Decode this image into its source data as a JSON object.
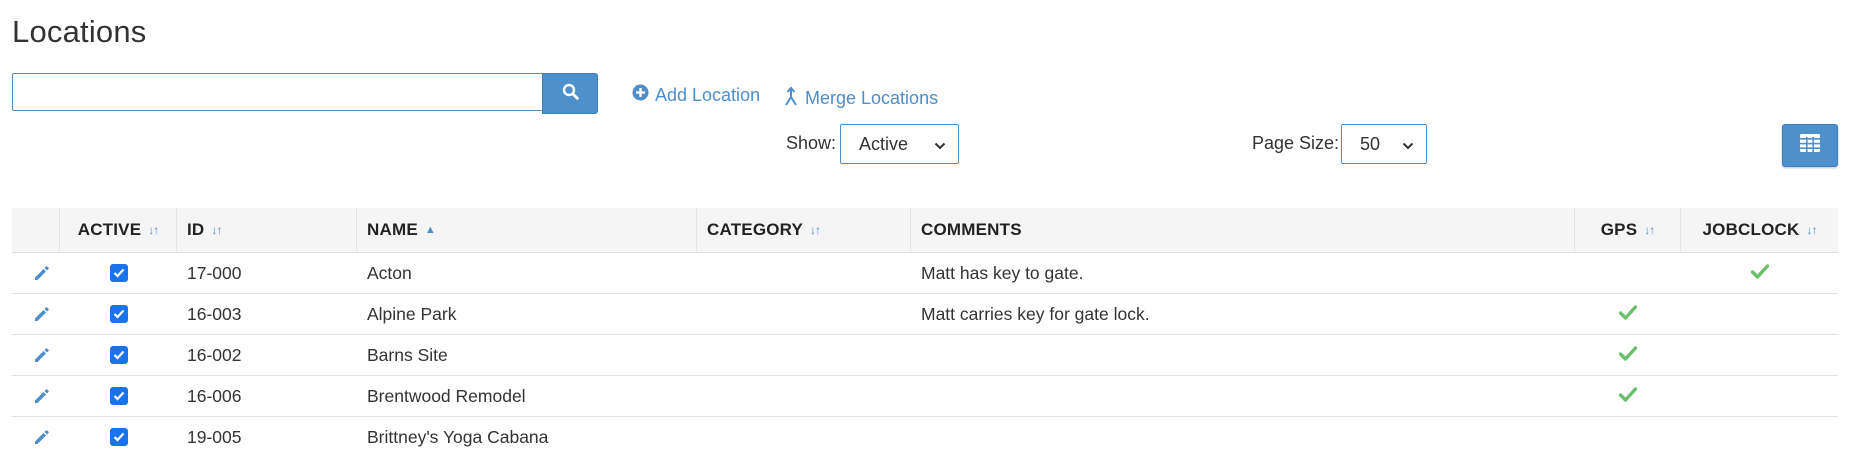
{
  "page": {
    "title": "Locations"
  },
  "toolbar": {
    "search_value": "",
    "search_placeholder": "",
    "add_label": "Add Location",
    "merge_label": "Merge Locations",
    "show_label": "Show:",
    "show_value": "Active",
    "page_size_label": "Page Size:",
    "page_size_value": "50"
  },
  "table": {
    "headers": {
      "active": "ACTIVE",
      "id": "ID",
      "name": "NAME",
      "category": "CATEGORY",
      "comments": "COMMENTS",
      "gps": "GPS",
      "jobclock": "JOBCLOCK"
    },
    "sorted_by": "name-ascending",
    "rows": [
      {
        "active": true,
        "id": "17-000",
        "name": "Acton",
        "category": "",
        "comments": "Matt has key to gate.",
        "gps": false,
        "jobclock": true
      },
      {
        "active": true,
        "id": "16-003",
        "name": "Alpine Park",
        "category": "",
        "comments": "Matt carries key for gate lock.",
        "gps": true,
        "jobclock": false
      },
      {
        "active": true,
        "id": "16-002",
        "name": "Barns Site",
        "category": "",
        "comments": "",
        "gps": true,
        "jobclock": false
      },
      {
        "active": true,
        "id": "16-006",
        "name": "Brentwood Remodel",
        "category": "",
        "comments": "",
        "gps": true,
        "jobclock": false
      },
      {
        "active": true,
        "id": "19-005",
        "name": "Brittney's Yoga Cabana",
        "category": "",
        "comments": "",
        "gps": false,
        "jobclock": false
      }
    ]
  },
  "icons": {
    "search": "search-icon",
    "add": "plus-circle-icon",
    "merge": "merge-icon",
    "columns": "grid-columns-icon",
    "edit": "pencil-icon",
    "check": "checkmark-icon",
    "sort": "sort-icon",
    "sort_asc": "sort-ascending-icon"
  },
  "colors": {
    "accent": "#4d90cc",
    "link": "#4f8ec9",
    "check_green": "#6cbf6c",
    "checkbox_blue": "#1a73e8",
    "header_bg": "#f5f5f5"
  }
}
